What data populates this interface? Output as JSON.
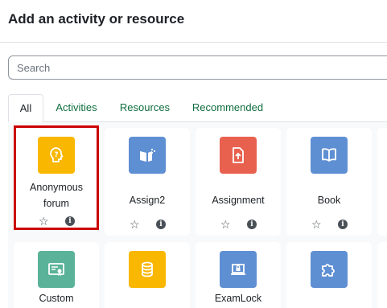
{
  "dialog": {
    "title": "Add an activity or resource"
  },
  "search": {
    "placeholder": "Search",
    "value": ""
  },
  "tabs": [
    {
      "label": "All",
      "active": true
    },
    {
      "label": "Activities",
      "active": false
    },
    {
      "label": "Resources",
      "active": false
    },
    {
      "label": "Recommended",
      "active": false
    }
  ],
  "modules": [
    {
      "label_line1": "Anonymous",
      "label_line2": "forum",
      "icon": "forum-question-icon",
      "color": "#f9b700",
      "selected": true
    },
    {
      "label_line1": "Assign2",
      "label_line2": "",
      "icon": "assign2-icon",
      "color": "#5f8fd3",
      "selected": false
    },
    {
      "label_line1": "Assignment",
      "label_line2": "",
      "icon": "assignment-upload-icon",
      "color": "#e8614f",
      "selected": false
    },
    {
      "label_line1": "Book",
      "label_line2": "",
      "icon": "book-icon",
      "color": "#5f8fd3",
      "selected": false
    },
    {
      "label_line1": "Custom",
      "label_line2": "",
      "icon": "certificate-icon",
      "color": "#5ab398",
      "selected": false
    },
    {
      "label_line1": "",
      "label_line2": "",
      "icon": "database-icon",
      "color": "#f9b700",
      "selected": false
    },
    {
      "label_line1": "ExamLock",
      "label_line2": "",
      "icon": "laptop-lock-icon",
      "color": "#5f8fd3",
      "selected": false
    },
    {
      "label_line1": "",
      "label_line2": "",
      "icon": "puzzle-icon",
      "color": "#5f8fd3",
      "selected": false
    }
  ]
}
